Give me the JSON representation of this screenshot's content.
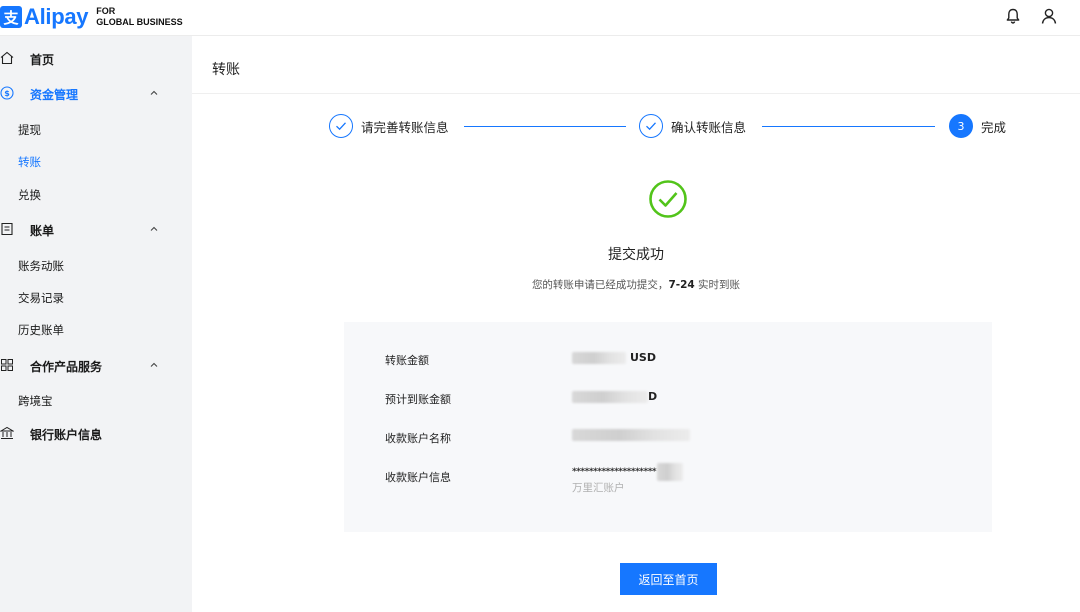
{
  "brand": {
    "logo_glyph": "支",
    "name": "Alipay",
    "sub_line1": "FOR",
    "sub_line2": "GLOBAL BUSINESS",
    "color": "#1677ff"
  },
  "topbar": {
    "icons": [
      "bell-icon",
      "user-icon"
    ]
  },
  "sidebar": {
    "home": "首页",
    "funds": {
      "label": "资金管理",
      "items": [
        "提现",
        "转账",
        "兑换"
      ],
      "active_item": "转账"
    },
    "bills": {
      "label": "账单",
      "items": [
        "账务动账",
        "交易记录",
        "历史账单"
      ]
    },
    "partners": {
      "label": "合作产品服务",
      "items": [
        "跨境宝"
      ]
    },
    "bank": "银行账户信息"
  },
  "page": {
    "title": "转账"
  },
  "steps": [
    {
      "label": "请完善转账信息",
      "status": "done"
    },
    {
      "label": "确认转账信息",
      "status": "done"
    },
    {
      "label": "完成",
      "status": "current",
      "number": "3"
    }
  ],
  "result": {
    "title": "提交成功",
    "desc_prefix": "您的转账申请已经成功提交，",
    "desc_bold": "7-24",
    "desc_suffix": " 实时到账",
    "icon_color": "#52c41a"
  },
  "details": {
    "amount_label": "转账金额",
    "amount_currency": "USD",
    "expected_label": "预计到账金额",
    "expected_suffix": "D",
    "name_label": "收款账户名称",
    "info_label": "收款账户信息",
    "info_masked": "********************",
    "info_note": "万里汇账户"
  },
  "actions": {
    "return_home": "返回至首页"
  }
}
